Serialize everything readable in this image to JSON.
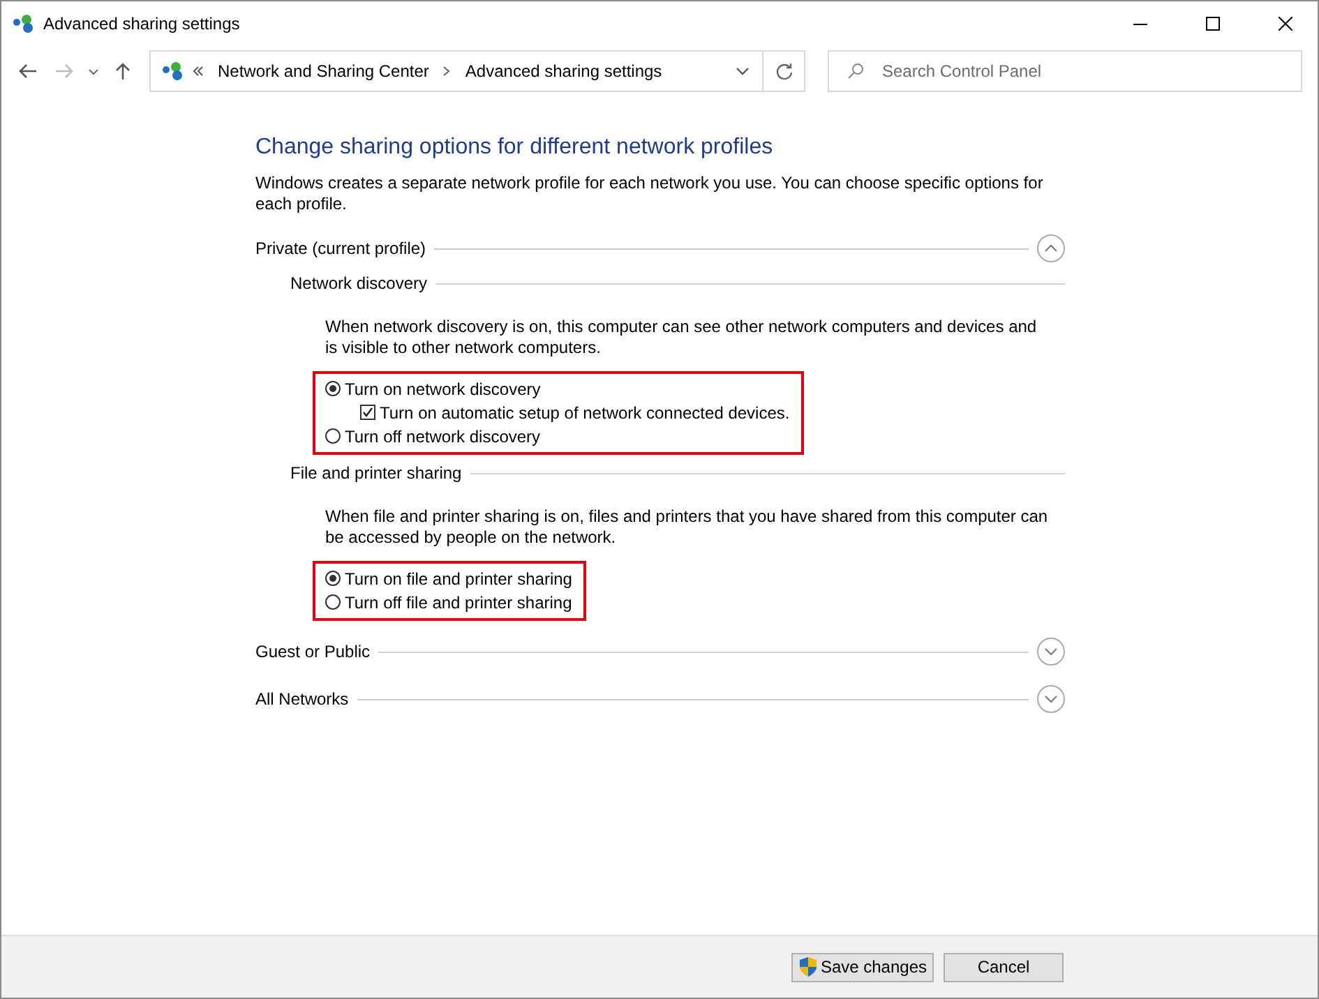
{
  "window": {
    "title": "Advanced sharing settings"
  },
  "address": {
    "crumbs": [
      "Network and Sharing Center",
      "Advanced sharing settings"
    ]
  },
  "search": {
    "placeholder": "Search Control Panel"
  },
  "heading": "Change sharing options for different network profiles",
  "intro": "Windows creates a separate network profile for each network you use. You can choose specific options for each profile.",
  "profiles": [
    {
      "name": "Private (current profile)",
      "expanded": true,
      "sections": [
        {
          "title": "Network discovery",
          "description": "When network discovery is on, this computer can see other network computers and devices and is visible to other network computers.",
          "highlighted": true,
          "options": [
            {
              "kind": "radio",
              "label": "Turn on network discovery",
              "selected": true,
              "children": [
                {
                  "kind": "checkbox",
                  "label": "Turn on automatic setup of network connected devices.",
                  "checked": true
                }
              ]
            },
            {
              "kind": "radio",
              "label": "Turn off network discovery",
              "selected": false
            }
          ]
        },
        {
          "title": "File and printer sharing",
          "description": "When file and printer sharing is on, files and printers that you have shared from this computer can be accessed by people on the network.",
          "highlighted": true,
          "options": [
            {
              "kind": "radio",
              "label": "Turn on file and printer sharing",
              "selected": true
            },
            {
              "kind": "radio",
              "label": "Turn off file and printer sharing",
              "selected": false
            }
          ]
        }
      ]
    },
    {
      "name": "Guest or Public",
      "expanded": false
    },
    {
      "name": "All Networks",
      "expanded": false
    }
  ],
  "buttons": [
    {
      "kind": "shield",
      "label": "Save changes"
    },
    {
      "kind": "plain",
      "label": "Cancel"
    }
  ]
}
